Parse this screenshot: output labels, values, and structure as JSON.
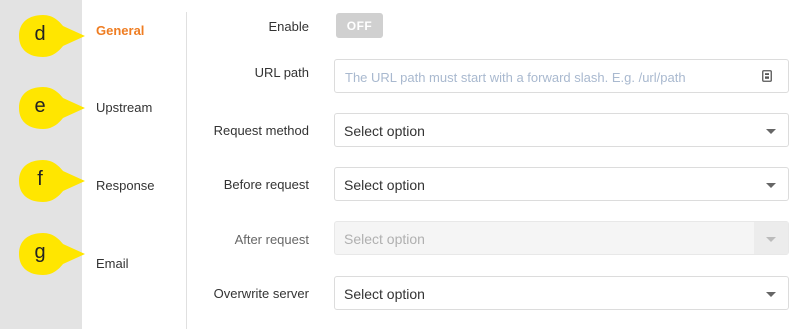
{
  "callouts": [
    "d",
    "e",
    "f",
    "g"
  ],
  "nav": [
    {
      "label": "General",
      "active": true
    },
    {
      "label": "Upstream",
      "active": false
    },
    {
      "label": "Response",
      "active": false
    },
    {
      "label": "Email",
      "active": false
    }
  ],
  "form": {
    "enable": {
      "label": "Enable",
      "toggle_text": "OFF"
    },
    "url_path": {
      "label": "URL path",
      "placeholder": "The URL path must start with a forward slash. E.g. /url/path"
    },
    "request_method": {
      "label": "Request method",
      "value": "Select option"
    },
    "before_request": {
      "label": "Before request",
      "value": "Select option"
    },
    "after_request": {
      "label": "After request",
      "value": "Select option",
      "disabled": true
    },
    "overwrite_server": {
      "label": "Overwrite server",
      "value": "Select option"
    }
  },
  "colors": {
    "callout": "#ffe600",
    "active_nav": "#ef7d22",
    "gutter": "#e3e3e3",
    "placeholder": "#a9b9cf"
  }
}
